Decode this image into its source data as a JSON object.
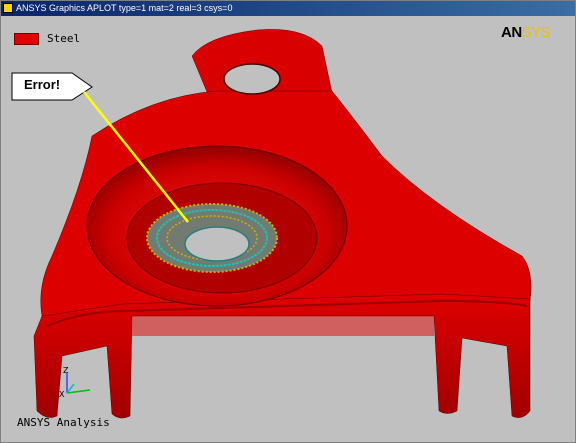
{
  "window": {
    "title": "ANSYS Graphics   APLOT  type=1 mat=2 real=3 csys=0"
  },
  "legend": {
    "label": "Steel",
    "color": "#e00000"
  },
  "logo": {
    "an": "AN",
    "sys": "SYS"
  },
  "callout": {
    "text": "Error!",
    "pointer_color": "#ffff00"
  },
  "footer": {
    "text": "ANSYS Analysis"
  },
  "triad": {
    "x_label": "X",
    "y_label": "Y",
    "z_label": "Z"
  },
  "model": {
    "part_color": "#dd0000",
    "mesh_color": "#40e0d0",
    "icon": "bracket-part-3d"
  }
}
